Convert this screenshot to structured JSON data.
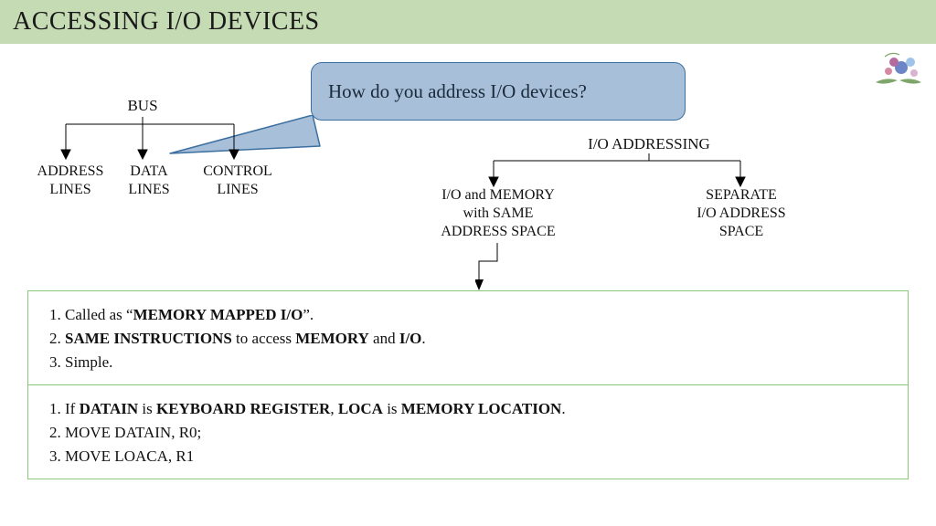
{
  "header": {
    "title": "ACCESSING I/O DEVICES"
  },
  "callout": {
    "text": "How do you address I/O devices?"
  },
  "bus": {
    "root": "BUS",
    "leaves": [
      {
        "l1": "ADDRESS",
        "l2": "LINES"
      },
      {
        "l1": "DATA",
        "l2": "LINES"
      },
      {
        "l1": "CONTROL",
        "l2": "LINES"
      }
    ]
  },
  "io_addressing": {
    "root": "I/O ADDRESSING",
    "leaves": [
      {
        "l1": "I/O and MEMORY",
        "l2": "with SAME",
        "l3": "ADDRESS SPACE"
      },
      {
        "l1": "SEPARATE",
        "l2": "I/O ADDRESS",
        "l3": "SPACE"
      }
    ]
  },
  "boxA": {
    "items": [
      {
        "prefix": "Called as “",
        "bold1": "MEMORY MAPPED I/O",
        "suffix": "”."
      },
      {
        "bold0": "SAME INSTRUCTIONS",
        "mid": " to access ",
        "bold1": "MEMORY",
        "mid2": " and ",
        "bold2": "I/O",
        "suffix": "."
      },
      {
        "plain": "Simple."
      }
    ]
  },
  "boxB": {
    "items": [
      {
        "prefix": "If ",
        "bold0": "DATAIN",
        "mid": " is ",
        "bold1": "KEYBOARD REGISTER",
        "mid2": ", ",
        "bold2": "LOCA",
        "mid3": " is ",
        "bold3": "MEMORY LOCATION",
        "suffix": "."
      },
      {
        "plain": "MOVE DATAIN, R0;"
      },
      {
        "plain": "MOVE LOACA, R1"
      }
    ]
  }
}
